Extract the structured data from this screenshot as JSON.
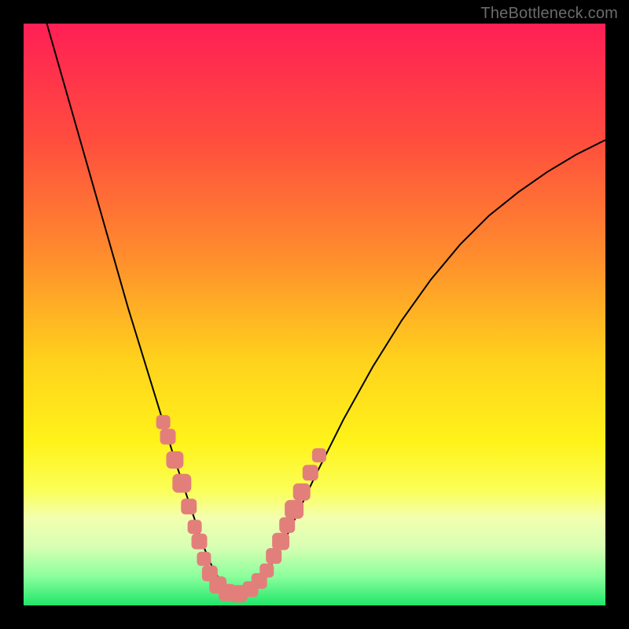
{
  "watermark": "TheBottleneck.com",
  "chart_data": {
    "type": "line",
    "title": "",
    "xlabel": "",
    "ylabel": "",
    "xlim": [
      0,
      100
    ],
    "ylim": [
      0,
      100
    ],
    "grid": false,
    "legend": false,
    "background_gradient": {
      "stops": [
        {
          "offset": 0.0,
          "color": "#ff1f55"
        },
        {
          "offset": 0.2,
          "color": "#ff4d3e"
        },
        {
          "offset": 0.4,
          "color": "#ff8d2d"
        },
        {
          "offset": 0.58,
          "color": "#ffd21c"
        },
        {
          "offset": 0.72,
          "color": "#fff31a"
        },
        {
          "offset": 0.8,
          "color": "#fbff55"
        },
        {
          "offset": 0.85,
          "color": "#f3ffb0"
        },
        {
          "offset": 0.9,
          "color": "#d7ffb3"
        },
        {
          "offset": 0.95,
          "color": "#8bff9d"
        },
        {
          "offset": 1.0,
          "color": "#20e66a"
        }
      ]
    },
    "series": [
      {
        "name": "curve",
        "color": "#000000",
        "stroke_width": 2,
        "x": [
          4,
          6,
          8,
          10,
          12,
          14,
          16,
          18,
          20,
          22,
          24,
          26,
          28,
          30,
          31,
          32,
          33,
          34,
          36,
          38,
          40,
          42,
          44,
          46,
          50,
          55,
          60,
          65,
          70,
          75,
          80,
          85,
          90,
          95,
          100
        ],
        "y": [
          100,
          93,
          86,
          79,
          72,
          65,
          58,
          51,
          44.5,
          38,
          31.5,
          25,
          19,
          13,
          10,
          7.5,
          5.5,
          4,
          2,
          2,
          3.5,
          6,
          9.5,
          13.5,
          22,
          32,
          41,
          49,
          56,
          62,
          67,
          71,
          74.5,
          77.5,
          80
        ]
      }
    ],
    "markers": {
      "name": "highlighted-points",
      "color": "#e37f7b",
      "shape": "rounded-square",
      "points": [
        {
          "x": 24.0,
          "y": 31.5,
          "r": 9
        },
        {
          "x": 24.8,
          "y": 29.0,
          "r": 10
        },
        {
          "x": 26.0,
          "y": 25.0,
          "r": 11
        },
        {
          "x": 27.2,
          "y": 21.0,
          "r": 12
        },
        {
          "x": 28.4,
          "y": 17.0,
          "r": 10
        },
        {
          "x": 29.4,
          "y": 13.5,
          "r": 9
        },
        {
          "x": 30.2,
          "y": 11.0,
          "r": 10
        },
        {
          "x": 31.0,
          "y": 8.0,
          "r": 9
        },
        {
          "x": 32.0,
          "y": 5.5,
          "r": 10
        },
        {
          "x": 33.4,
          "y": 3.5,
          "r": 11
        },
        {
          "x": 35.0,
          "y": 2.2,
          "r": 11
        },
        {
          "x": 37.0,
          "y": 2.0,
          "r": 11
        },
        {
          "x": 39.0,
          "y": 2.8,
          "r": 10
        },
        {
          "x": 40.5,
          "y": 4.2,
          "r": 10
        },
        {
          "x": 41.8,
          "y": 6.0,
          "r": 9
        },
        {
          "x": 43.0,
          "y": 8.5,
          "r": 10
        },
        {
          "x": 44.2,
          "y": 11.0,
          "r": 11
        },
        {
          "x": 45.3,
          "y": 13.8,
          "r": 10
        },
        {
          "x": 46.5,
          "y": 16.5,
          "r": 12
        },
        {
          "x": 47.8,
          "y": 19.5,
          "r": 11
        },
        {
          "x": 49.3,
          "y": 22.8,
          "r": 10
        },
        {
          "x": 50.8,
          "y": 25.8,
          "r": 9
        }
      ]
    }
  }
}
